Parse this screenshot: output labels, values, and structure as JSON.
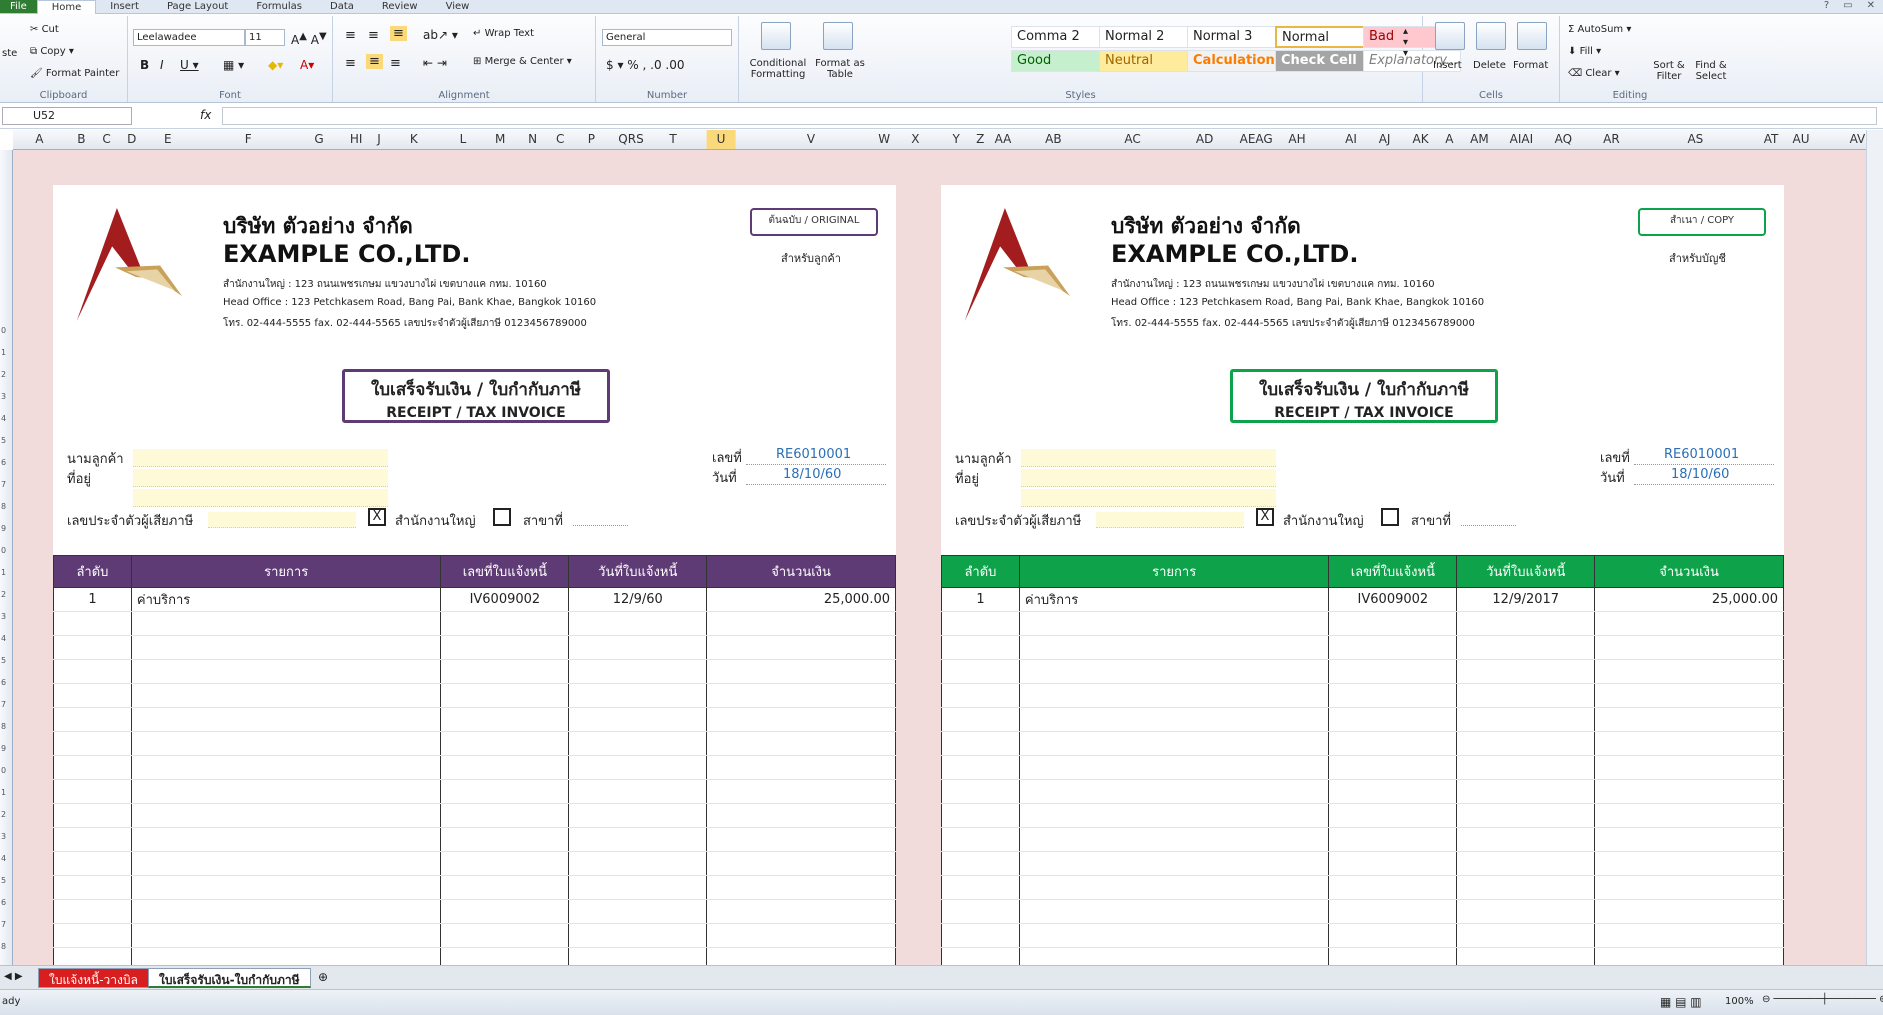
{
  "ribbon_tabs": [
    "File",
    "Home",
    "Insert",
    "Page Layout",
    "Formulas",
    "Data",
    "Review",
    "View"
  ],
  "clipboard": {
    "cut": "Cut",
    "copy": "Copy",
    "format_painter": "Format Painter",
    "paste": "ste",
    "label": "Clipboard"
  },
  "font": {
    "name": "Leelawadee",
    "size": "11",
    "label": "Font"
  },
  "alignment": {
    "wrap": "Wrap Text",
    "merge": "Merge & Center",
    "label": "Alignment"
  },
  "number": {
    "format": "General",
    "label": "Number"
  },
  "styles": {
    "cond": "Conditional Formatting",
    "table": "Format as Table",
    "label": "Styles",
    "cells": [
      {
        "name": "Comma 2",
        "bg": "#ffffff",
        "fg": "#222222"
      },
      {
        "name": "Normal 2",
        "bg": "#ffffff",
        "fg": "#222222"
      },
      {
        "name": "Normal 3",
        "bg": "#ffffff",
        "fg": "#222222"
      },
      {
        "name": "Normal",
        "bg": "#ffffff",
        "fg": "#222222"
      },
      {
        "name": "Bad",
        "bg": "#ffc7ce",
        "fg": "#9c0006"
      },
      {
        "name": "Good",
        "bg": "#c6efce",
        "fg": "#006100"
      },
      {
        "name": "Neutral",
        "bg": "#ffeb9c",
        "fg": "#9c6500"
      },
      {
        "name": "Calculation",
        "bg": "#f2f2f2",
        "fg": "#fa7d00"
      },
      {
        "name": "Check Cell",
        "bg": "#a5a5a5",
        "fg": "#ffffff"
      },
      {
        "name": "Explanatory...",
        "bg": "#ffffff",
        "fg": "#7f7f7f"
      }
    ]
  },
  "cells_group": {
    "insert": "Insert",
    "delete": "Delete",
    "format": "Format",
    "label": "Cells"
  },
  "editing": {
    "autosum": "AutoSum",
    "fill": "Fill",
    "clear": "Clear",
    "sort": "Sort & Filter",
    "find": "Find & Select",
    "label": "Editing"
  },
  "formula_bar": {
    "cell_ref": "U52",
    "fx": "fx",
    "content": ""
  },
  "columns": [
    "A",
    "B",
    "C",
    "D",
    "E",
    "F",
    "G",
    "HI",
    "J",
    "K",
    "L",
    "M",
    "N",
    "C",
    "P",
    "QRS",
    "T",
    "U",
    "V",
    "W",
    "X",
    "Y",
    "Z",
    "AA",
    "AB",
    "AC",
    "AD",
    "AEAG",
    "AH",
    "AI",
    "AJ",
    "AK",
    "A",
    "AM",
    "AIAI",
    "AQ",
    "AR",
    "AS",
    "AT",
    "AU",
    "AV"
  ],
  "selected_column": "U",
  "rows": [
    "",
    "",
    "",
    "",
    "",
    "",
    "",
    "",
    "0",
    "1",
    "2",
    "3",
    "4",
    "5",
    "6",
    "7",
    "8",
    "9",
    "0",
    "1",
    "2",
    "3",
    "4",
    "5",
    "6",
    "7",
    "8",
    "9",
    "0",
    "1",
    "2",
    "3",
    "4",
    "5",
    "6",
    "7",
    "8",
    "9"
  ],
  "docs": [
    {
      "accent": "#5e3b74",
      "company_th": "บริษัท  ตัวอย่าง  จำกัด",
      "company_en": "EXAMPLE CO.,LTD.",
      "addr_th": "สำนักงานใหญ่ : 123  ถนนเพชรเกษม  แขวงบางไผ่  เขตบางแค  กทม. 10160",
      "addr_en": "Head Office : 123  Petchkasem Road, Bang Pai, Bank Khae, Bangkok 10160",
      "contact": "โทร. 02-444-5555    fax. 02-444-5565    เลขประจำตัวผู้เสียภาษี  0123456789000",
      "tag": "ต้นฉบับ  / ORIGINAL",
      "tag_sub": "สำหรับลูกค้า",
      "title_th": "ใบเสร็จรับเงิน  / ใบกำกับภาษี",
      "title_en": "RECEIPT /  TAX INVOICE",
      "lbl_customer": "นามลูกค้า",
      "lbl_address": "ที่อยู่",
      "lbl_taxid": "เลขประจำตัวผู้เสียภาษี",
      "lbl_no": "เลขที่",
      "val_no": "RE6010001",
      "lbl_date": "วันที่",
      "val_date": "18/10/60",
      "hq_mark": "X",
      "lbl_hq": "สำนักงานใหญ่",
      "lbl_branch": "สาขาที่",
      "headers": [
        "ลำดับ",
        "รายการ",
        "เลขที่ใบแจ้งหนี้",
        "วันที่ใบแจ้งหนี้",
        "จำนวนเงิน"
      ],
      "items": [
        {
          "no": "1",
          "desc": "ค่าบริการ",
          "inv": "IV6009002",
          "date": "12/9/60",
          "amount": "25,000.00"
        }
      ]
    },
    {
      "accent": "#0ea34a",
      "company_th": "บริษัท  ตัวอย่าง  จำกัด",
      "company_en": "EXAMPLE CO.,LTD.",
      "addr_th": "สำนักงานใหญ่ : 123  ถนนเพชรเกษม  แขวงบางไผ่  เขตบางแค  กทม. 10160",
      "addr_en": "Head Office : 123  Petchkasem Road, Bang Pai, Bank Khae, Bangkok 10160",
      "contact": "โทร. 02-444-5555    fax. 02-444-5565    เลขประจำตัวผู้เสียภาษี  0123456789000",
      "tag": "สำเนา  / COPY",
      "tag_sub": "สำหรับบัญชี",
      "title_th": "ใบเสร็จรับเงิน  / ใบกำกับภาษี",
      "title_en": "RECEIPT /  TAX INVOICE",
      "lbl_customer": "นามลูกค้า",
      "lbl_address": "ที่อยู่",
      "lbl_taxid": "เลขประจำตัวผู้เสียภาษี",
      "lbl_no": "เลขที่",
      "val_no": "RE6010001",
      "lbl_date": "วันที่",
      "val_date": "18/10/60",
      "hq_mark": "X",
      "lbl_hq": "สำนักงานใหญ่",
      "lbl_branch": "สาขาที่",
      "headers": [
        "ลำดับ",
        "รายการ",
        "เลขที่ใบแจ้งหนี้",
        "วันที่ใบแจ้งหนี้",
        "จำนวนเงิน"
      ],
      "items": [
        {
          "no": "1",
          "desc": "ค่าบริการ",
          "inv": "IV6009002",
          "date": "12/9/2017",
          "amount": "25,000.00"
        }
      ]
    }
  ],
  "sheet_tabs": [
    "ใบแจ้งหนี้-วางบิล",
    "ใบเสร็จรับเงิน-ใบกำกับภาษี"
  ],
  "status": {
    "ready": "ady",
    "zoom": "100%"
  }
}
